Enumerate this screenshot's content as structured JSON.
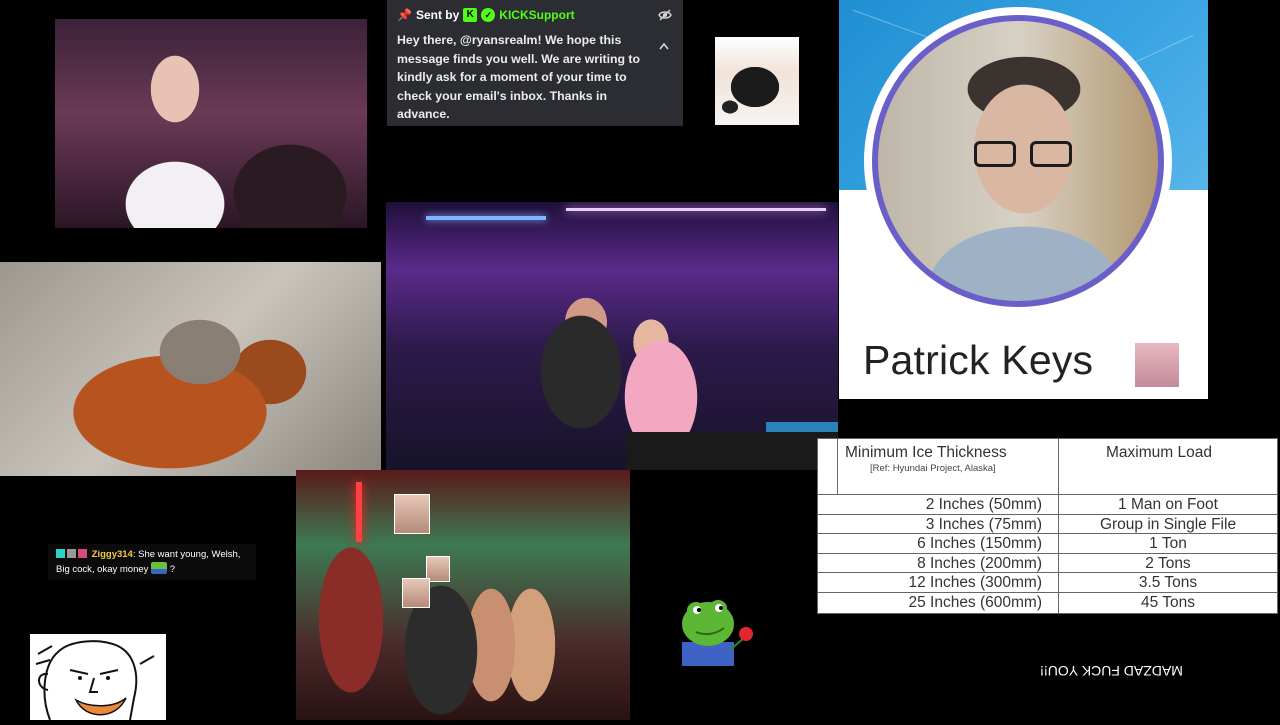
{
  "kick_message": {
    "sent_by_label": "Sent by",
    "sender": "KICKSupport",
    "logo_letter": "K",
    "body": "Hey there, @ryansrealm! We hope this message finds you well. We are writing to kindly ask for a moment of your time to check your email's inbox. Thanks in advance.",
    "accent_color": "#53fc18",
    "icons": [
      "pin-icon",
      "kick-logo-icon",
      "verified-badge-icon",
      "eye-off-icon",
      "chevron-up-icon"
    ]
  },
  "profile": {
    "name": "Patrick Keys",
    "ring_color": "#6a5fc9",
    "banner_color": "#2b98d8"
  },
  "ice_table": {
    "headers": {
      "thickness": "Minimum Ice Thickness",
      "reference": "[Ref: Hyundai Project, Alaska]",
      "load": "Maximum Load"
    },
    "rows": [
      {
        "thickness": "2 Inches (50mm)",
        "load": "1 Man on Foot"
      },
      {
        "thickness": "3 Inches (75mm)",
        "load": "Group in Single File"
      },
      {
        "thickness": "6 Inches (150mm)",
        "load": "1 Ton"
      },
      {
        "thickness": "8 Inches (200mm)",
        "load": "2 Tons"
      },
      {
        "thickness": "12 Inches (300mm)",
        "load": "3.5 Tons"
      },
      {
        "thickness": "25 Inches (600mm)",
        "load": "45 Tons"
      }
    ]
  },
  "chat": {
    "username": "Ziggy314",
    "separator": ":",
    "message": "She want young, Welsh, Big cock, okay money",
    "trailing": "?",
    "username_color": "#f2c94c"
  },
  "overlay_text": "MADZAD FUCK YOU!!"
}
